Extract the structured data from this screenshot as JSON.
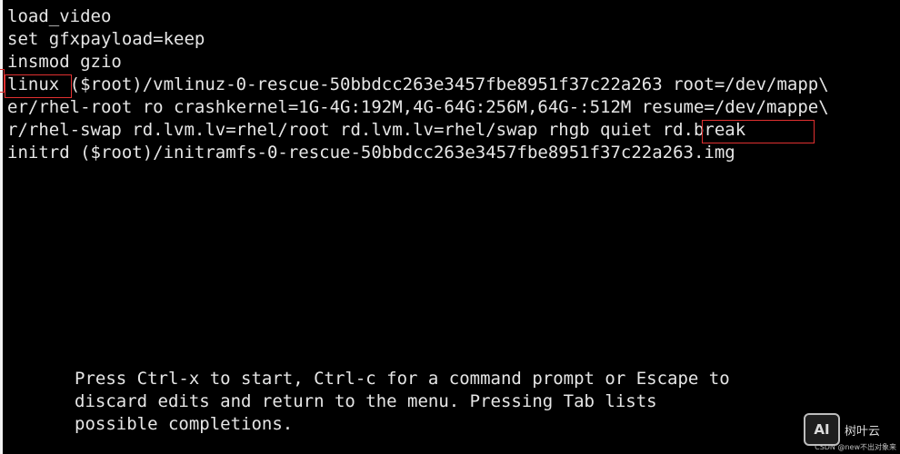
{
  "editor": {
    "lines": [
      "load_video",
      "set gfxpayload=keep",
      "insmod gzio",
      "linux ($root)/vmlinuz-0-rescue-50bbdcc263e3457fbe8951f37c22a263 root=/dev/mapp\\",
      "er/rhel-root ro crashkernel=1G-4G:192M,4G-64G:256M,64G-:512M resume=/dev/mappe\\",
      "r/rhel-swap rd.lvm.lv=rhel/root rd.lvm.lv=rhel/swap rhgb quiet rd.break",
      "initrd ($root)/initramfs-0-rescue-50bbdcc263e3457fbe8951f37c22a263.img"
    ],
    "highlights": [
      "linux",
      "rd.break"
    ],
    "highlight_color": "#e03030"
  },
  "help": {
    "lines": [
      "Press Ctrl-x to start, Ctrl-c for a command prompt or Escape to",
      "discard edits and return to the menu. Pressing Tab lists",
      "possible completions."
    ]
  },
  "watermark": {
    "logo": "AI",
    "brand": "树叶云",
    "credit": "CSDN @new不出对象来"
  },
  "colors": {
    "background": "#000000",
    "text": "#e6e6e6"
  }
}
